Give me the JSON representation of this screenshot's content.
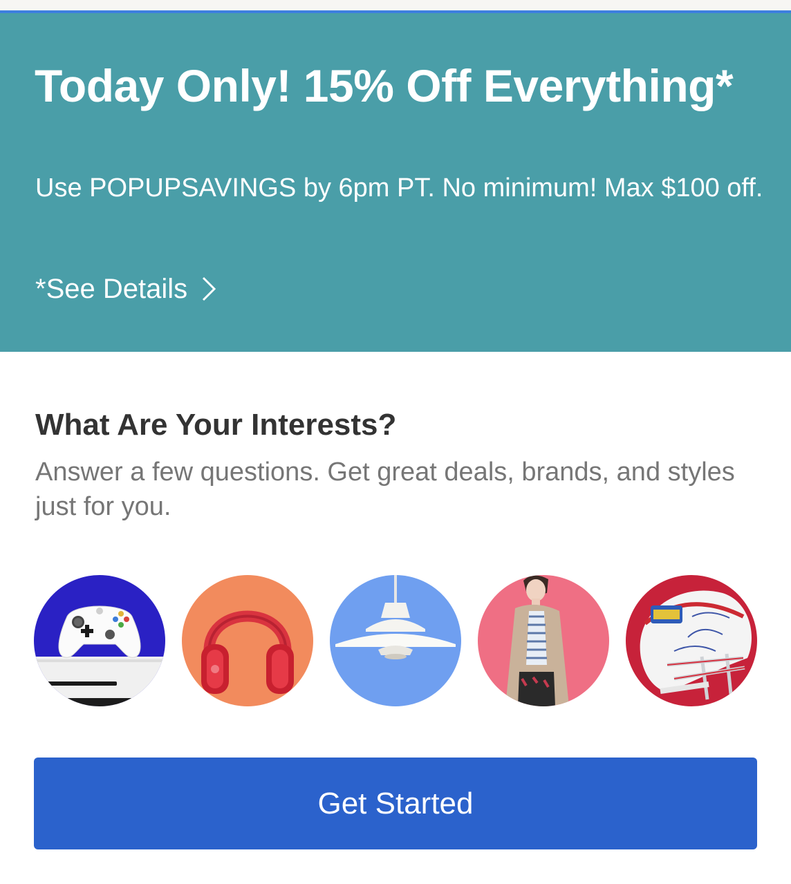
{
  "promo": {
    "title": "Today Only! 15% Off Everything*",
    "subtitle": "Use POPUPSAVINGS by 6pm PT. No minimum! Max $100 off.",
    "details_link": "*See Details",
    "background_color": "#4a9ea8"
  },
  "interests": {
    "title": "What Are Your Interests?",
    "subtitle": "Answer a few questions. Get great deals, brands, and styles just for you.",
    "categories": [
      {
        "icon": "game-controller-icon",
        "background_color": "#2a21c4"
      },
      {
        "icon": "headphones-icon",
        "background_color": "#f28b5d"
      },
      {
        "icon": "pendant-lamp-icon",
        "background_color": "#6f9ff0"
      },
      {
        "icon": "fashion-model-icon",
        "background_color": "#ef6f84"
      },
      {
        "icon": "football-helmet-icon",
        "background_color": "#c7223a"
      }
    ]
  },
  "cta": {
    "label": "Get Started",
    "background_color": "#2b62cc"
  }
}
